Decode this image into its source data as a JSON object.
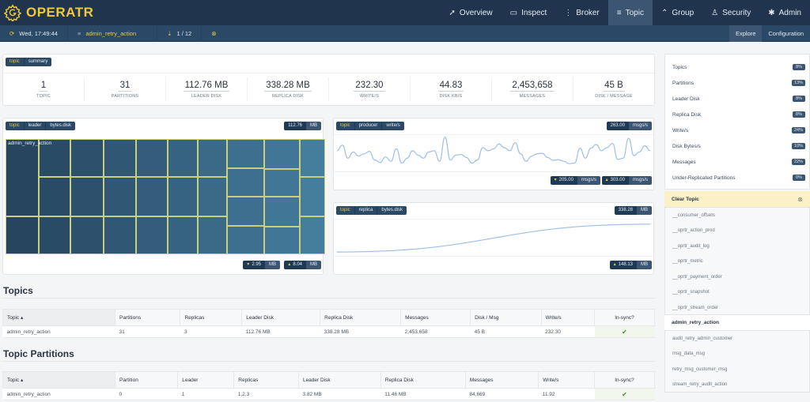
{
  "app": {
    "name": "OPERATR",
    "brand_color": "#f0c93a",
    "nav_bg": "#20344d"
  },
  "nav": [
    {
      "label": "Overview",
      "icon": "send-icon",
      "glyph": "➚",
      "active": false
    },
    {
      "label": "Inspect",
      "icon": "folder-icon",
      "glyph": "▭",
      "active": false
    },
    {
      "label": "Broker",
      "icon": "server-icon",
      "glyph": "⋮",
      "active": false
    },
    {
      "label": "Topic",
      "icon": "list-icon",
      "glyph": "≡",
      "active": true
    },
    {
      "label": "Group",
      "icon": "group-icon",
      "glyph": "⌃",
      "active": false
    },
    {
      "label": "Security",
      "icon": "user-icon",
      "glyph": "♙",
      "active": false
    },
    {
      "label": "Admin",
      "icon": "gear-icon",
      "glyph": "✱",
      "active": false
    }
  ],
  "subbar": {
    "refresh_time": "Wed, 17:49:44",
    "topic": "admin_retry_action",
    "sort_position": "1 / 12",
    "tabs": [
      {
        "label": "Explore",
        "active": true
      },
      {
        "label": "Configuration",
        "active": false
      }
    ]
  },
  "summary": {
    "tags": [
      "topic",
      "summary"
    ],
    "stats": [
      {
        "value": "1",
        "label": "TOPIC"
      },
      {
        "value": "31",
        "label": "PARTITIONS"
      },
      {
        "value": "112.76 MB",
        "label": "LEADER DISK"
      },
      {
        "value": "338.28 MB",
        "label": "REPLICA DISK"
      },
      {
        "value": "232.30",
        "label": "WRITE/S"
      },
      {
        "value": "44.83",
        "label": "DISK KB/S"
      },
      {
        "value": "2,453,658",
        "label": "MESSAGES"
      },
      {
        "value": "45 B",
        "label": "DISK / MESSAGE"
      }
    ]
  },
  "leader_card": {
    "tags": [
      "topic",
      "leader",
      "bytes.disk"
    ],
    "total": {
      "value": "112.76",
      "unit": "MB"
    },
    "treemap_label": "admin_retry_action",
    "min": {
      "value": "2.95",
      "unit": "MB"
    },
    "max": {
      "value": "8.04",
      "unit": "MB"
    }
  },
  "producer_card": {
    "tags": [
      "topic",
      "producer",
      "write/s"
    ],
    "total": {
      "value": "263.00",
      "unit": "msgs/s"
    },
    "min": {
      "value": "205.00",
      "unit": "msgs/s"
    },
    "max": {
      "value": "303.00",
      "unit": "msgs/s"
    }
  },
  "replica_card": {
    "tags": [
      "topic",
      "replica",
      "bytes.disk"
    ],
    "total": {
      "value": "338.28",
      "unit": "MB"
    },
    "max": {
      "value": "148.13",
      "unit": "MB"
    }
  },
  "chart_data": [
    {
      "type": "heatmap",
      "title": "topic leader bytes.disk (treemap)",
      "label": "admin_retry_action",
      "unit": "MB",
      "range": [
        2.95,
        8.04
      ],
      "partitions": 31
    },
    {
      "type": "line",
      "title": "topic producer write/s",
      "unit": "msgs/s",
      "ylim": [
        205,
        303
      ],
      "values": [
        262,
        280,
        238,
        258,
        245,
        252,
        260,
        232,
        224,
        242,
        228,
        268,
        222,
        238,
        262,
        248,
        238,
        258,
        262,
        228,
        306,
        232,
        248,
        250,
        240,
        222,
        232,
        272,
        262,
        268,
        284,
        272,
        262,
        288,
        252,
        228,
        244,
        252,
        254,
        240,
        231,
        233,
        228,
        220,
        222,
        270,
        238,
        270,
        282,
        262,
        272,
        286,
        234,
        238,
        302,
        246,
        258,
        278,
        262
      ]
    },
    {
      "type": "line",
      "title": "topic replica bytes.disk",
      "unit": "MB",
      "values": [
        0,
        148.13
      ]
    }
  ],
  "topics_section": {
    "title": "Topics",
    "columns": [
      "Topic ▴",
      "Partitions",
      "Replicas",
      "Leader Disk",
      "Replica Disk",
      "Messages",
      "Disk / Msg",
      "Write/s",
      "In-sync?"
    ],
    "rows": [
      [
        "admin_retry_action",
        "31",
        "3",
        "112.76 MB",
        "338.28 MB",
        "2,453,658",
        "45 B",
        "232.30",
        "✔"
      ]
    ]
  },
  "partitions_section": {
    "title": "Topic Partitions",
    "columns": [
      "Topic ▴",
      "Partition",
      "Leader",
      "Replicas",
      "Leader Disk",
      "Replica Disk",
      "Messages",
      "Write/s",
      "In-sync?"
    ],
    "rows": [
      [
        "admin_retry_action",
        "0",
        "1",
        "1,2,3",
        "3.82 MB",
        "11.46 MB",
        "84,669",
        "11.92",
        "✔"
      ]
    ]
  },
  "sidebar": {
    "metrics": [
      {
        "label": "Topics",
        "pct": "8%"
      },
      {
        "label": "Partitions",
        "pct": "13%"
      },
      {
        "label": "Leader Disk",
        "pct": "8%"
      },
      {
        "label": "Replica Disk",
        "pct": "8%"
      },
      {
        "label": "Write/s",
        "pct": "24%"
      },
      {
        "label": "Disk Bytes/s",
        "pct": "10%"
      },
      {
        "label": "Messages",
        "pct": "22%"
      },
      {
        "label": "Under-Replicated Partitions",
        "pct": "0%"
      }
    ],
    "clear_label": "Clear Topic",
    "topics_before": [
      "__consumer_offsets",
      "__oprtr_action_prod",
      "__oprtr_audit_log",
      "__oprtr_metric",
      "__oprtr_payment_order",
      "__oprtr_snapshot",
      "__oprtr_stream_order"
    ],
    "selected": "admin_retry_action",
    "topics_after": [
      "audit_retry_admin_customer",
      "msg_data_msg",
      "retry_msg_customer_msg",
      "stream_retry_audit_action"
    ]
  }
}
